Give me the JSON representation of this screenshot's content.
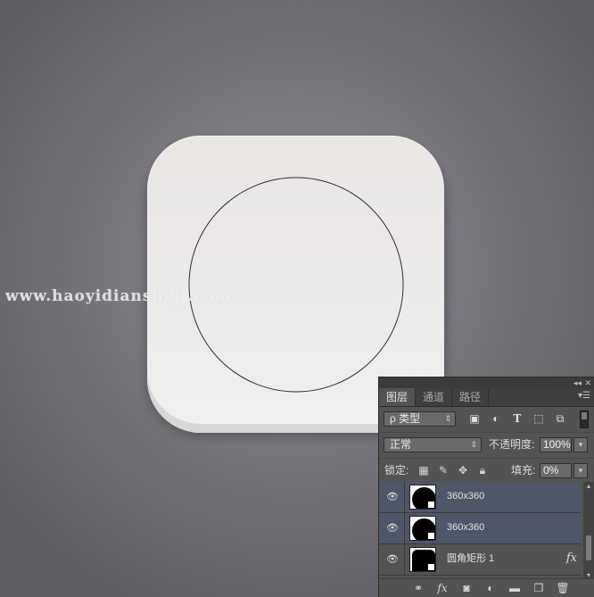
{
  "canvas": {
    "watermark": "www.haoyidiansheji.com"
  },
  "layers_panel": {
    "tabs": [
      {
        "label": "图层",
        "active": true
      },
      {
        "label": "通道",
        "active": false
      },
      {
        "label": "路径",
        "active": false
      }
    ],
    "filter": {
      "kind_label": "ρ 类型",
      "icons": [
        "pixel-filter-icon",
        "adjustment-filter-icon",
        "type-filter-icon",
        "shape-filter-icon",
        "smart-object-filter-icon"
      ]
    },
    "blend": {
      "mode": "正常",
      "opacity_label": "不透明度:",
      "opacity_value": "100%"
    },
    "lock": {
      "label": "锁定:",
      "icons": [
        "lock-transparent-icon",
        "lock-image-icon",
        "lock-position-icon",
        "lock-all-icon"
      ],
      "fill_label": "填充:",
      "fill_value": "0%"
    },
    "layers": [
      {
        "name": "360x360",
        "selected": true,
        "visible": true,
        "thumb": "circle"
      },
      {
        "name": "360x360",
        "selected": true,
        "visible": true,
        "thumb": "circle"
      },
      {
        "name": "圆角矩形 1",
        "selected": false,
        "visible": true,
        "thumb": "rounded-rect",
        "fx": "fx"
      }
    ],
    "bottom_icons": [
      "link-layers-icon",
      "fx-icon",
      "add-mask-icon",
      "adjustment-layer-icon",
      "new-group-icon",
      "new-layer-icon",
      "delete-icon"
    ]
  }
}
